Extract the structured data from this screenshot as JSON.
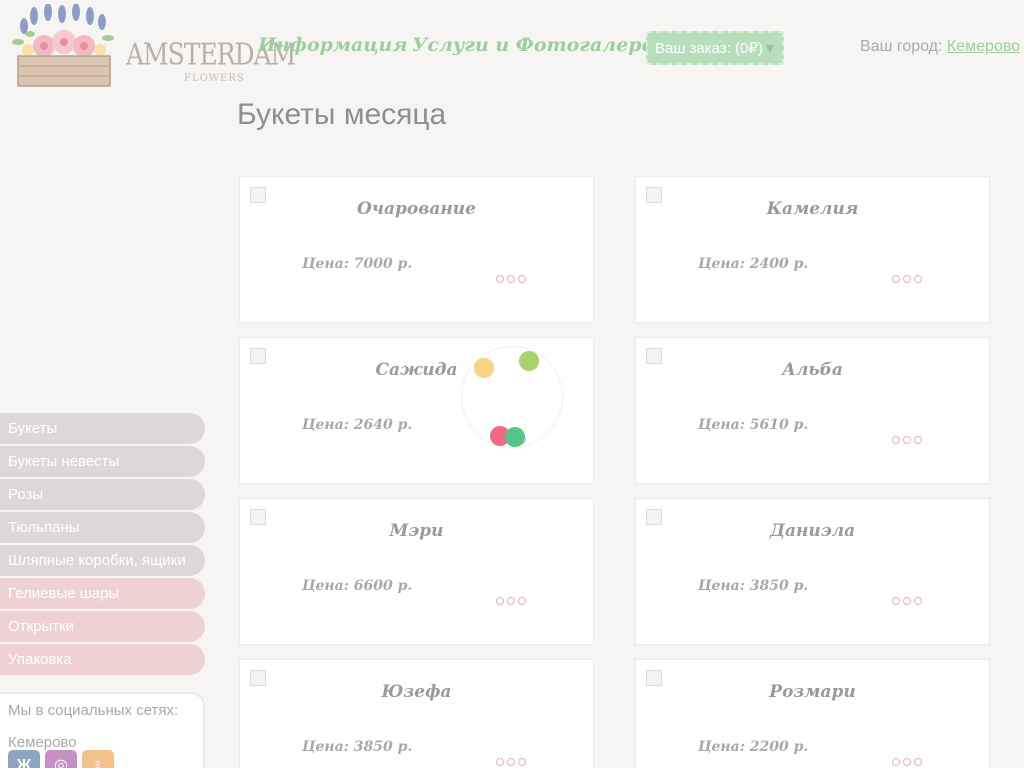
{
  "header": {
    "logo_text": "AMSTERDAM",
    "logo_sub": "FLOWERS",
    "nav": [
      {
        "label": "Информация"
      },
      {
        "label": "Услуги и Фотогалерея"
      }
    ],
    "order_label": "Ваш заказ: (0₽)",
    "city_label": "Ваш город:",
    "city_value": "Кемерово"
  },
  "page_title": "Букеты месяца",
  "sidebar": {
    "items": [
      {
        "label": "Букеты",
        "style": "grey"
      },
      {
        "label": "Букеты невесты",
        "style": "grey"
      },
      {
        "label": "Розы",
        "style": "grey"
      },
      {
        "label": "Тюльпаны",
        "style": "grey"
      },
      {
        "label": "Шляпные коробки, ящики",
        "style": "grey"
      },
      {
        "label": "Гелиевые шары",
        "style": "pink"
      },
      {
        "label": "Открытки",
        "style": "pink"
      },
      {
        "label": "Упаковка",
        "style": "pink"
      }
    ],
    "social_title": "Мы в социальных сетях:",
    "social_city": "Кемерово",
    "social_icons": [
      "vk-icon",
      "instagram-icon",
      "odnoklassniki-icon"
    ]
  },
  "products": [
    {
      "name": "Очарование",
      "price": "Цена: 7000 р."
    },
    {
      "name": "Камелия",
      "price": "Цена: 2400 р."
    },
    {
      "name": "Сажида",
      "price": "Цена: 2640 р."
    },
    {
      "name": "Альба",
      "price": "Цена: 5610 р."
    },
    {
      "name": "Мэри",
      "price": "Цена: 6600 р."
    },
    {
      "name": "Даниэла",
      "price": "Цена: 3850 р."
    },
    {
      "name": "Юзефа",
      "price": "Цена: 3850 р."
    },
    {
      "name": "Розмари",
      "price": "Цена: 2200 р."
    }
  ],
  "colors": {
    "background": "#f7f5f3",
    "accent_green": "#9ccf9c",
    "menu_grey": "#dcd8d8",
    "menu_pink": "#eed1d3",
    "dot_pink": "#e7b1b6"
  }
}
